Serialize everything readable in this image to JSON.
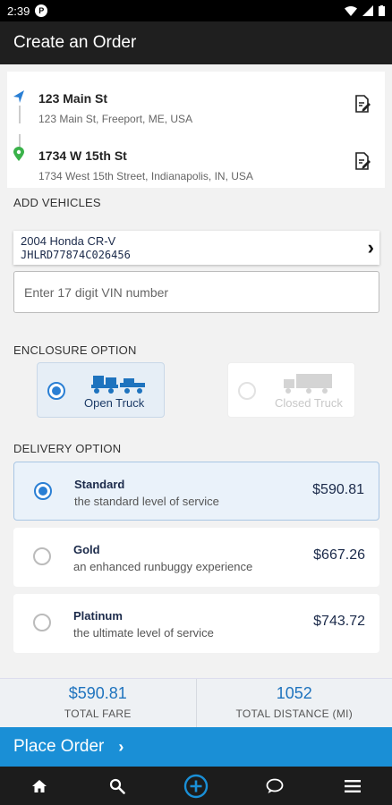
{
  "status_bar": {
    "time": "2:39",
    "notif_icon": "P"
  },
  "app_bar": {
    "title": "Create an Order"
  },
  "addresses": [
    {
      "name": "123 Main St",
      "full": "123 Main St, Freeport, ME, USA",
      "pin_color": "#2a7fd4"
    },
    {
      "name": "1734 W 15th St",
      "full": "1734 West 15th Street, Indianapolis, IN, USA",
      "pin_color": "#3ab24a"
    }
  ],
  "vehicles": {
    "section_label": "ADD VEHICLES",
    "items": [
      {
        "name": "2004 Honda CR-V",
        "vin": "JHLRD77874C026456"
      }
    ],
    "vin_placeholder": "Enter 17 digit VIN number"
  },
  "enclosure": {
    "section_label": "ENCLOSURE OPTION",
    "options": [
      {
        "label": "Open Truck",
        "selected": true
      },
      {
        "label": "Closed Truck",
        "selected": false,
        "disabled": true
      }
    ]
  },
  "delivery": {
    "section_label": "DELIVERY OPTION",
    "options": [
      {
        "title": "Standard",
        "desc": "the standard level of service",
        "price": "$590.81",
        "selected": true
      },
      {
        "title": "Gold",
        "desc": "an enhanced runbuggy experience",
        "price": "$667.26",
        "selected": false
      },
      {
        "title": "Platinum",
        "desc": "the ultimate level of service",
        "price": "$743.72",
        "selected": false
      }
    ]
  },
  "totals": {
    "fare_value": "$590.81",
    "fare_label": "TOTAL FARE",
    "distance_value": "1052",
    "distance_label": "TOTAL DISTANCE (MI)"
  },
  "place_order": {
    "label": "Place Order"
  },
  "bottom_nav": [
    "home-icon",
    "search-icon",
    "add-circle-icon",
    "chat-icon",
    "menu-icon"
  ],
  "colors": {
    "accent": "#1a8fd6",
    "app_bar": "#1f1f1f",
    "radio": "#2a7fd4"
  }
}
